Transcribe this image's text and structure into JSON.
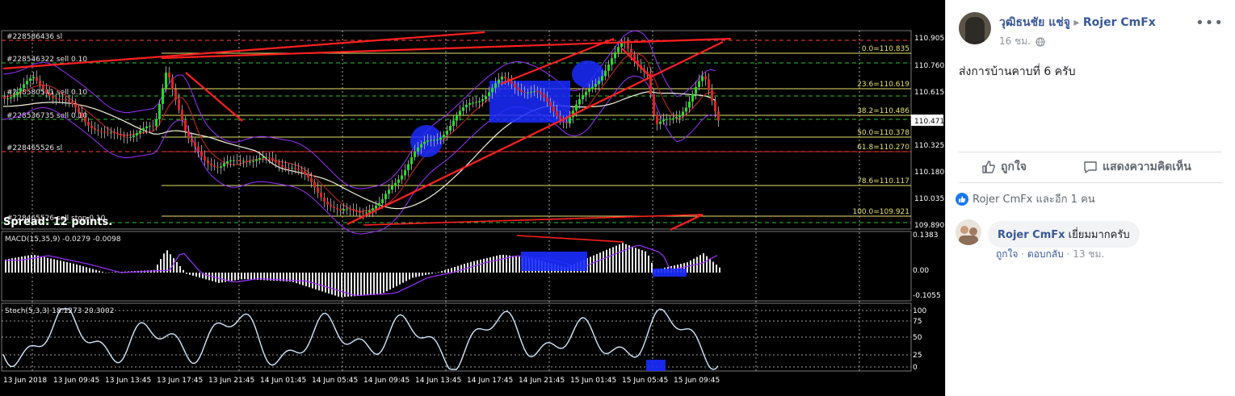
{
  "chart": {
    "spread_text": "Spread: 12 points.",
    "orders": [
      "#228586436 sl",
      "#228546322 sell 0.10",
      "#228580541 sell 0.10",
      "#228536735 sell 0.10",
      "#228465526 sl",
      "#228465526 sell stop 0.10"
    ],
    "price_scale": [
      "110.905",
      "110.760",
      "110.615",
      "110.471",
      "110.325",
      "110.180",
      "110.035",
      "109.890"
    ],
    "current_price": "110.471",
    "fib_levels": [
      "0.0=110.835",
      "23.6=110.619",
      "38.2=110.486",
      "50.0=110.378",
      "61.8=110.270",
      "78.6=110.117",
      "100.0=109.921"
    ],
    "macd_label": "MACD(15,35,9) -0.0279 -0.0098",
    "macd_scale": [
      "0.1383",
      "0.00",
      "-0.1055"
    ],
    "stoch_label": "Stoch(5,3,3) 18.1273 20.3002",
    "stoch_scale": [
      "100",
      "75",
      "50",
      "25",
      "0"
    ],
    "time_labels": [
      "13 Jun 2018",
      "13 Jun 09:45",
      "13 Jun 13:45",
      "13 Jun 17:45",
      "13 Jun 21:45",
      "14 Jun 01:45",
      "14 Jun 05:45",
      "14 Jun 09:45",
      "14 Jun 13:45",
      "14 Jun 17:45",
      "14 Jun 21:45",
      "15 Jun 01:45",
      "15 Jun 05:45",
      "15 Jun 09:45"
    ]
  },
  "post": {
    "author": "วุฒิธนชัย แช่จู",
    "target": "Rojer CmFx",
    "time": "16 ชม.",
    "text": "ส่งการบ้านคาบที่ 6 ครับ",
    "like_label": "ถูกใจ",
    "comment_label": "แสดงความคิดเห็น",
    "reactions_text": "Rojer CmFx และอีก 1 คน",
    "comment": {
      "author": "Rojer CmFx",
      "text": "เยี่ยมมากครับ",
      "like": "ถูกใจ",
      "reply": "ตอบกลับ",
      "time": "13 ชม."
    }
  },
  "colors": {
    "fb_blue": "#385898",
    "fb_like": "#1877f2",
    "candle_up": "#22dd22",
    "candle_down": "#dd2222",
    "trend_line": "#ff2020"
  }
}
